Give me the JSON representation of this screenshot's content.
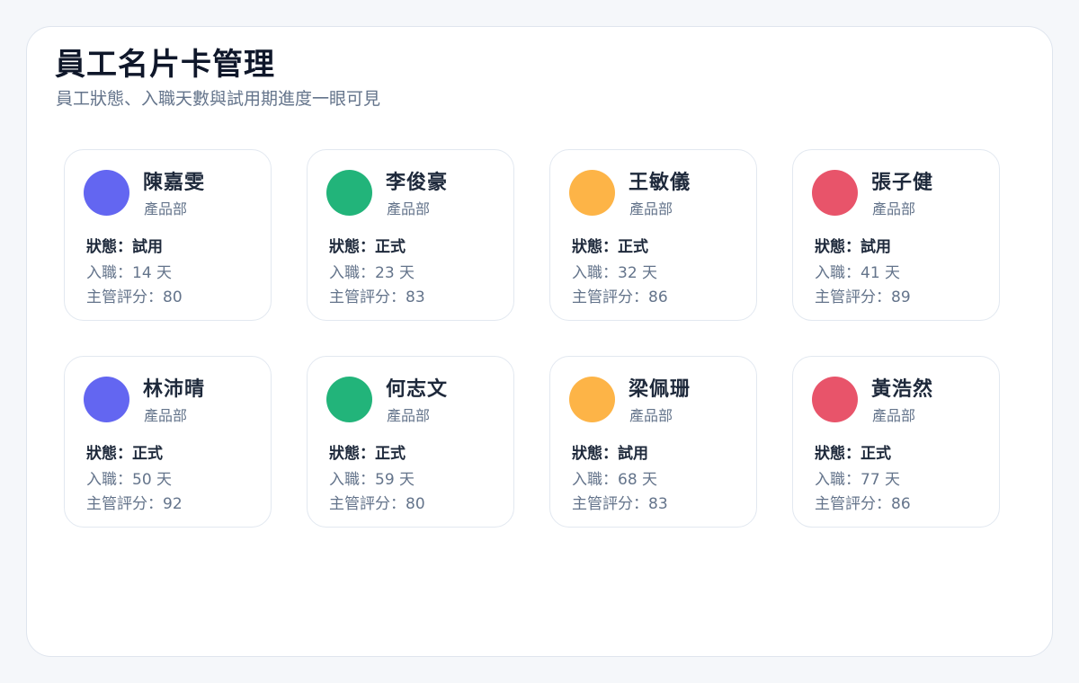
{
  "header": {
    "title": "員工名片卡管理",
    "subtitle": "員工狀態、入職天數與試用期進度一眼可見"
  },
  "labels": {
    "status_prefix": "狀態：",
    "joined_prefix": "入職：",
    "joined_suffix": " 天",
    "score_prefix": "主管評分："
  },
  "colors": {
    "indigo": "#6366f1",
    "green": "#22b47a",
    "amber": "#fdb447",
    "red": "#e8546a"
  },
  "employees": [
    {
      "name": "陳嘉雯",
      "dept": "產品部",
      "status": "試用",
      "days": "14",
      "score": "80",
      "avatar_color": "#6366f1"
    },
    {
      "name": "李俊豪",
      "dept": "產品部",
      "status": "正式",
      "days": "23",
      "score": "83",
      "avatar_color": "#22b47a"
    },
    {
      "name": "王敏儀",
      "dept": "產品部",
      "status": "正式",
      "days": "32",
      "score": "86",
      "avatar_color": "#fdb447"
    },
    {
      "name": "張子健",
      "dept": "產品部",
      "status": "試用",
      "days": "41",
      "score": "89",
      "avatar_color": "#e8546a"
    },
    {
      "name": "林沛晴",
      "dept": "產品部",
      "status": "正式",
      "days": "50",
      "score": "92",
      "avatar_color": "#6366f1"
    },
    {
      "name": "何志文",
      "dept": "產品部",
      "status": "正式",
      "days": "59",
      "score": "80",
      "avatar_color": "#22b47a"
    },
    {
      "name": "梁佩珊",
      "dept": "產品部",
      "status": "試用",
      "days": "68",
      "score": "83",
      "avatar_color": "#fdb447"
    },
    {
      "name": "黃浩然",
      "dept": "產品部",
      "status": "正式",
      "days": "77",
      "score": "86",
      "avatar_color": "#e8546a"
    }
  ]
}
